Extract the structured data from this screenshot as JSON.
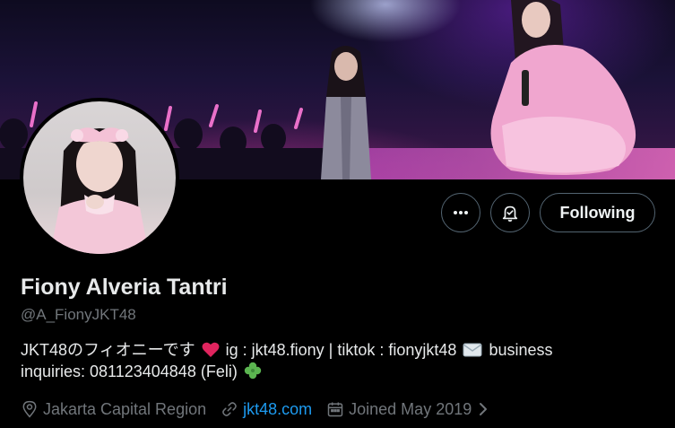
{
  "profile": {
    "name": "Fiony Alveria Tantri",
    "handle": "@A_FionyJKT48",
    "bio_line1_a": "JKT48のフィオニーです",
    "bio_line1_b": "ig : jkt48.fiony | tiktok : fionyjkt48",
    "bio_line1_c": "business",
    "bio_line2_a": "inquiries: 081123404848 (Feli)",
    "location": "Jakarta Capital Region",
    "website": "jkt48.com",
    "joined": "Joined May 2019"
  },
  "actions": {
    "following_label": "Following"
  },
  "icons": {
    "more": "more-icon",
    "notifications": "bell-icon",
    "location": "location-pin-icon",
    "website": "link-icon",
    "joined": "calendar-icon",
    "bio_heart": "heart-emoji",
    "bio_envelope": "envelope-emoji",
    "bio_clover": "clover-emoji"
  },
  "colors": {
    "background": "#000000",
    "text_primary": "#e7e9ea",
    "text_secondary": "#71767b",
    "link": "#1d9bf0",
    "button_border": "#536471",
    "heart": "#e0245e",
    "clover": "#5bb450"
  }
}
